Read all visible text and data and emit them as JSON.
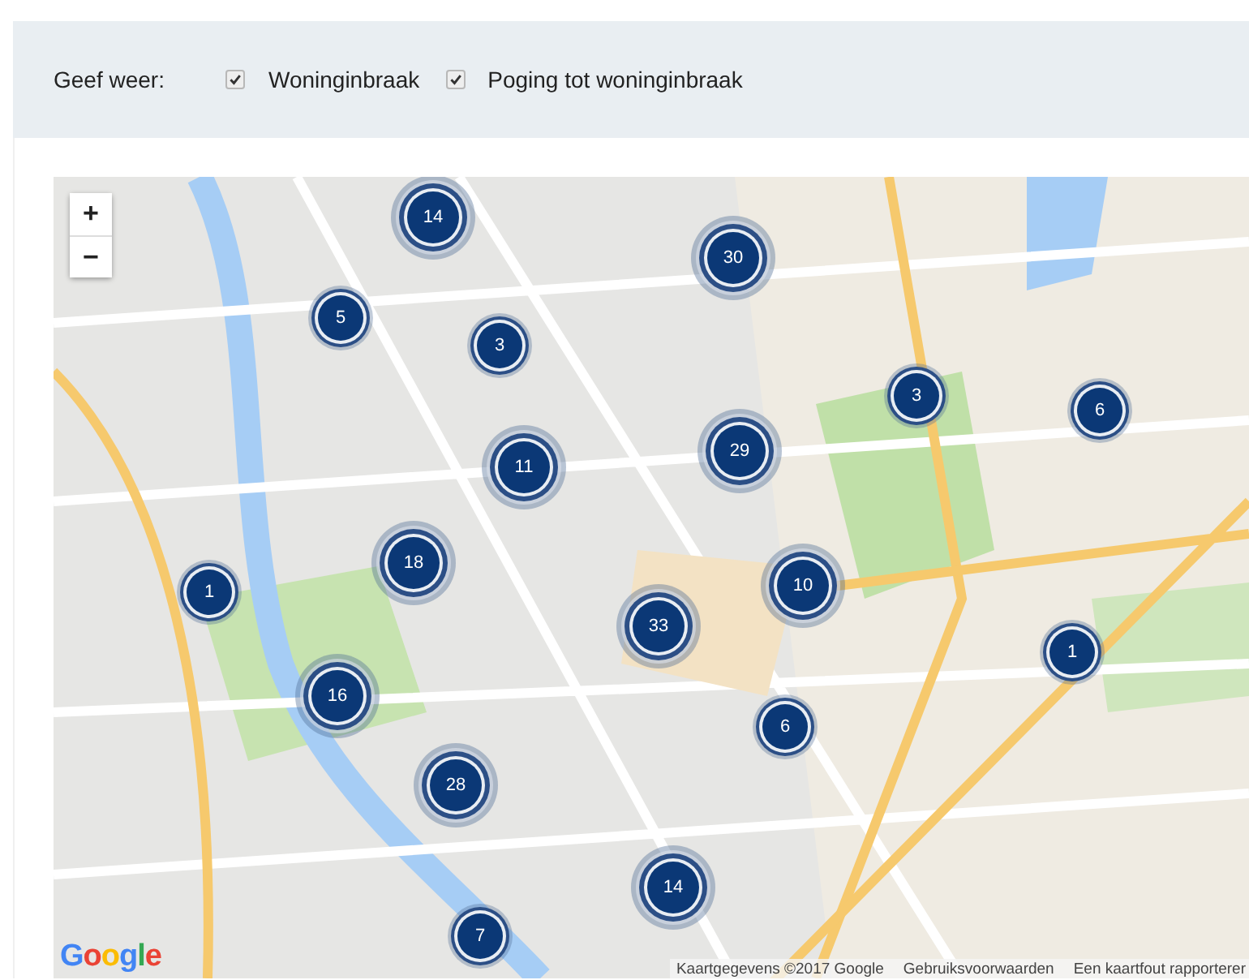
{
  "filter_bar": {
    "label": "Geef weer:",
    "options": [
      {
        "label": "Woninginbraak",
        "checked": true
      },
      {
        "label": "Poging tot woninginbraak",
        "checked": true
      }
    ]
  },
  "map": {
    "zoom_in": "+",
    "zoom_out": "−",
    "clusters": [
      {
        "count": "14"
      },
      {
        "count": "30"
      },
      {
        "count": "5"
      },
      {
        "count": "3"
      },
      {
        "count": "3"
      },
      {
        "count": "6"
      },
      {
        "count": "11"
      },
      {
        "count": "29"
      },
      {
        "count": "18"
      },
      {
        "count": "1"
      },
      {
        "count": "10"
      },
      {
        "count": "33"
      },
      {
        "count": "1"
      },
      {
        "count": "16"
      },
      {
        "count": "6"
      },
      {
        "count": "28"
      },
      {
        "count": "14"
      },
      {
        "count": "7"
      }
    ],
    "logo": "Google",
    "attribution": [
      "Kaartgegevens ©2017 Google",
      "Gebruiksvoorwaarden",
      "Een kaartfout rapporterer"
    ]
  }
}
